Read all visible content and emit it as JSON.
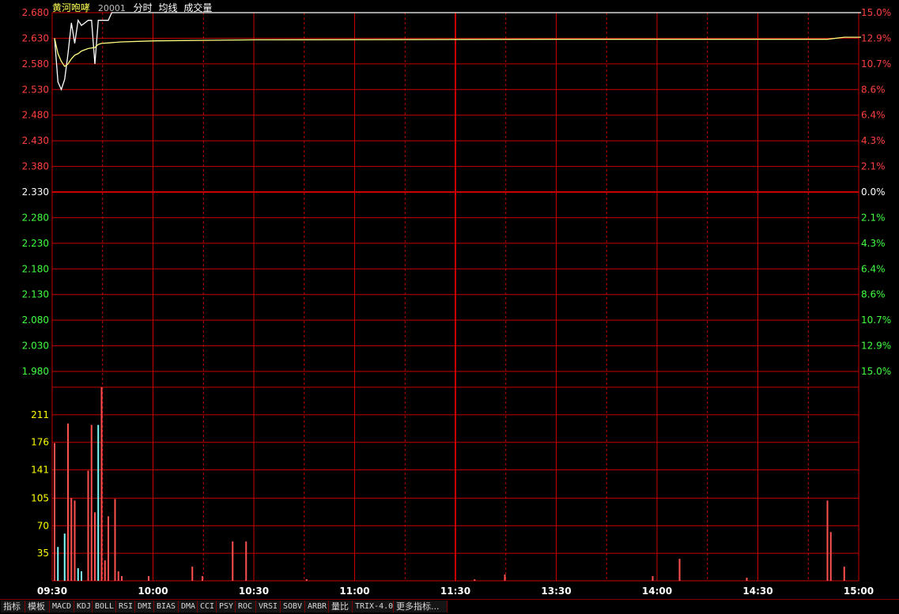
{
  "header": {
    "stock_name": "黄河咆哮",
    "stock_code": "20001",
    "indicators": [
      "分时",
      "均线",
      "成交量"
    ]
  },
  "tabs": [
    "指标",
    "模板",
    "MACD",
    "KDJ",
    "BOLL",
    "RSI",
    "DMI",
    "BIAS",
    "DMA",
    "CCI",
    "PSY",
    "ROC",
    "VRSI",
    "SOBV",
    "ARBR",
    "量比",
    "TRIX-4.0",
    "更多指标..."
  ],
  "colors": {
    "grid": "#c80000",
    "price_line": "#ffffff",
    "avg_line": "#ffff80",
    "up_label": "#ff4040",
    "down_label": "#40ff40",
    "neutral_label": "#ffffff",
    "volume_up": "#ff5050",
    "volume_down": "#80ffff",
    "volume_axis": "#ffff00",
    "time_axis": "#ffffff"
  },
  "chart_data": [
    {
      "type": "line",
      "title": "",
      "prev_close": 2.33,
      "ylim": [
        1.98,
        2.68
      ],
      "y_ticks": [
        "2.680",
        "2.630",
        "2.580",
        "2.530",
        "2.480",
        "2.430",
        "2.380",
        "2.330",
        "2.280",
        "2.230",
        "2.180",
        "2.130",
        "2.080",
        "2.030",
        "1.980"
      ],
      "y_ticks_right": [
        "15.0%",
        "12.9%",
        "10.7%",
        "8.6%",
        "6.4%",
        "4.3%",
        "2.1%",
        "0.0%",
        "2.1%",
        "4.3%",
        "6.4%",
        "8.6%",
        "10.7%",
        "12.9%",
        "15.0%"
      ],
      "x_ticks": [
        "09:30",
        "10:00",
        "10:30",
        "11:00",
        "11:30",
        "13:30",
        "14:00",
        "14:30",
        "15:00"
      ],
      "xlim": [
        0,
        240
      ],
      "series": [
        {
          "name": "分时",
          "x": [
            0,
            1,
            2,
            3,
            4,
            5,
            6,
            7,
            8,
            9,
            10,
            11,
            12,
            13,
            14,
            15,
            16,
            17,
            18,
            240
          ],
          "y": [
            2.63,
            2.545,
            2.53,
            2.55,
            2.6,
            2.66,
            2.62,
            2.665,
            2.655,
            2.66,
            2.665,
            2.665,
            2.58,
            2.665,
            2.665,
            2.665,
            2.665,
            2.68,
            2.68,
            2.68
          ]
        },
        {
          "name": "均线",
          "x": [
            0,
            1,
            2,
            3,
            4,
            5,
            6,
            7,
            8,
            10,
            12,
            13,
            14,
            16,
            18,
            20,
            30,
            60,
            150,
            200,
            230,
            235,
            240
          ],
          "y": [
            2.63,
            2.6,
            2.585,
            2.575,
            2.58,
            2.59,
            2.597,
            2.6,
            2.605,
            2.61,
            2.612,
            2.618,
            2.62,
            2.621,
            2.622,
            2.623,
            2.625,
            2.627,
            2.628,
            2.628,
            2.628,
            2.632,
            2.632
          ]
        }
      ]
    },
    {
      "type": "bar",
      "title": "",
      "ylim": [
        0,
        246
      ],
      "y_ticks": [
        "211",
        "176",
        "141",
        "105",
        "70",
        "35"
      ],
      "bars": [
        {
          "x": 0,
          "v": 175,
          "dir": "up"
        },
        {
          "x": 1,
          "v": 43,
          "dir": "down"
        },
        {
          "x": 3,
          "v": 60,
          "dir": "down"
        },
        {
          "x": 4,
          "v": 200,
          "dir": "up"
        },
        {
          "x": 5,
          "v": 105,
          "dir": "up"
        },
        {
          "x": 6,
          "v": 102,
          "dir": "up"
        },
        {
          "x": 7,
          "v": 16,
          "dir": "down"
        },
        {
          "x": 8,
          "v": 12,
          "dir": "down"
        },
        {
          "x": 10,
          "v": 140,
          "dir": "up"
        },
        {
          "x": 11,
          "v": 198,
          "dir": "up"
        },
        {
          "x": 12,
          "v": 87,
          "dir": "up"
        },
        {
          "x": 13,
          "v": 198,
          "dir": "down"
        },
        {
          "x": 14,
          "v": 246,
          "dir": "up"
        },
        {
          "x": 15,
          "v": 26,
          "dir": "up"
        },
        {
          "x": 16,
          "v": 82,
          "dir": "up"
        },
        {
          "x": 18,
          "v": 104,
          "dir": "up"
        },
        {
          "x": 19,
          "v": 12,
          "dir": "up"
        },
        {
          "x": 20,
          "v": 6,
          "dir": "up"
        },
        {
          "x": 28,
          "v": 6,
          "dir": "up"
        },
        {
          "x": 41,
          "v": 18,
          "dir": "up"
        },
        {
          "x": 44,
          "v": 6,
          "dir": "up"
        },
        {
          "x": 53,
          "v": 50,
          "dir": "up"
        },
        {
          "x": 57,
          "v": 50,
          "dir": "up"
        },
        {
          "x": 75,
          "v": 2,
          "dir": "up"
        },
        {
          "x": 125,
          "v": 2,
          "dir": "up"
        },
        {
          "x": 134,
          "v": 8,
          "dir": "up"
        },
        {
          "x": 178,
          "v": 6,
          "dir": "up"
        },
        {
          "x": 186,
          "v": 28,
          "dir": "up"
        },
        {
          "x": 206,
          "v": 4,
          "dir": "up"
        },
        {
          "x": 230,
          "v": 102,
          "dir": "up"
        },
        {
          "x": 231,
          "v": 62,
          "dir": "up"
        },
        {
          "x": 235,
          "v": 18,
          "dir": "up"
        }
      ]
    }
  ]
}
